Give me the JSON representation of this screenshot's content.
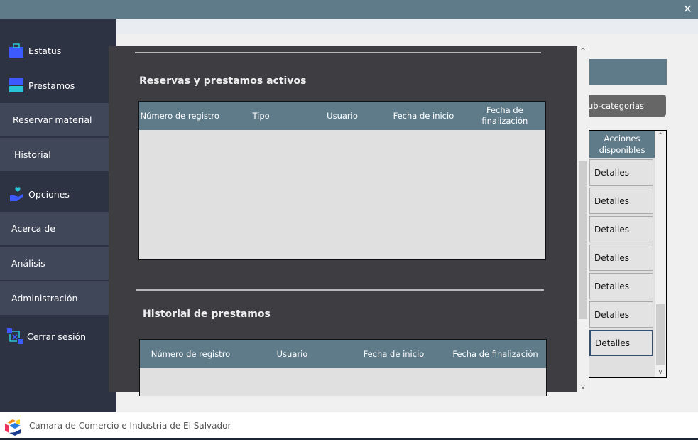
{
  "window": {
    "close_icon": "close-icon"
  },
  "sidebar": {
    "items": [
      {
        "label": "Estatus",
        "icon": "briefcase-icon"
      },
      {
        "label": "Prestamos",
        "icon": "drawer-icon"
      },
      {
        "label": "Reservar material"
      },
      {
        "label": "Historial"
      },
      {
        "label": "Opciones",
        "icon": "hand-heart-icon"
      },
      {
        "label": "Acerca de"
      },
      {
        "label": "Análisis"
      },
      {
        "label": "Administración"
      },
      {
        "label": "Cerrar sesión",
        "icon": "logout-swap-icon"
      }
    ]
  },
  "panel": {
    "active_title": "Reservas y prestamos activos",
    "active_headers": [
      "Número de registro",
      "Tipo",
      "Usuario",
      "Fecha de inicio",
      "Fecha de finalización"
    ],
    "history_title": "Historial de prestamos",
    "history_headers": [
      "Número de registro",
      "Usuario",
      "Fecha de inicio",
      "Fecha de finalización"
    ]
  },
  "right": {
    "subcat_button": "ub-categorias",
    "actions_header": "Acciones disponibles",
    "details": [
      "Detalles",
      "Detalles",
      "Detalles",
      "Detalles",
      "Detalles",
      "Detalles",
      "Detalles"
    ]
  },
  "footer": {
    "org": "Camara de Comercio e Industria de El Salvador"
  }
}
